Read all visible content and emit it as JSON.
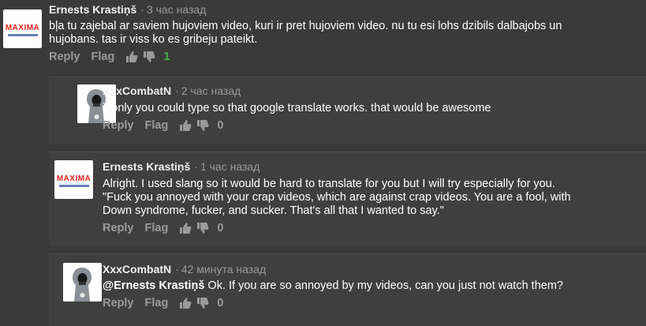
{
  "actions": {
    "reply": "Reply",
    "flag": "Flag"
  },
  "comments": [
    {
      "author": "Ernests Krastiņš",
      "time": "3 час назад",
      "avatar": "maxima-logo",
      "avatar_text": "MAXIMA",
      "body_line1": "bļa tu zajebal ar saviem hujoviem video, kuri ir pret hujoviem video. nu tu esi lohs dzibils dalbajobs un",
      "body_line2": "hujobans. tas ir viss ko es gribeju pateikt.",
      "votes": "1"
    },
    {
      "author": "XxxCombatN",
      "time": "2 час назад",
      "avatar": "hooded-figure",
      "body_line1": "if only you could type so that google translate works. that would be awesome",
      "votes": "0"
    },
    {
      "author": "Ernests Krastiņš",
      "time": "1 час назад",
      "avatar": "maxima-logo",
      "avatar_text": "MAXIMA",
      "body_line1": "Alright. I used slang so it would be hard to translate for you but I will try especially for you.",
      "body_line2": "\"Fuck you annoyed with your crap videos, which are against crap videos. You are a fool, with",
      "body_line3": "Down syndrome, fucker, and sucker. That's all that I wanted to say.\"",
      "votes": "0"
    },
    {
      "author": "XxxCombatN",
      "time": "42 минута назад",
      "avatar": "hooded-figure",
      "mention": "@Ernests Krastiņš",
      "body_line1": " Ok. If you are so annoyed by my videos, can you just not watch them?",
      "votes": "0"
    }
  ],
  "colors": {
    "background": "#3a3a3a",
    "card": "#3f3f3f",
    "meta": "#9a9a9a",
    "positive": "#4caf50",
    "brand_red": "#e2231a"
  }
}
